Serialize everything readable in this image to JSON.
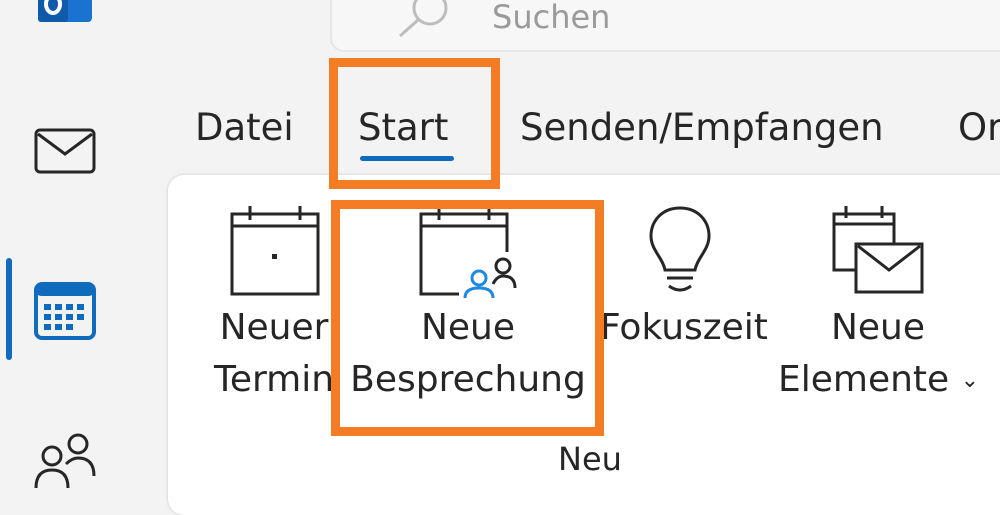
{
  "app": {
    "brand_color": "#0f6cbd",
    "highlight_color": "#f47c25"
  },
  "nav_rail": {
    "items": [
      {
        "icon": "outlook-logo-icon"
      },
      {
        "icon": "mail-icon"
      },
      {
        "icon": "calendar-icon",
        "active": true
      },
      {
        "icon": "people-icon"
      }
    ]
  },
  "search": {
    "placeholder": "Suchen"
  },
  "tabs": [
    {
      "label": "Datei"
    },
    {
      "label": "Start",
      "active": true
    },
    {
      "label": "Senden/Empfangen"
    },
    {
      "label": "Or"
    }
  ],
  "ribbon": {
    "buttons": [
      {
        "label_line1": "Neuer",
        "label_line2": "Termin",
        "icon": "calendar-new-icon"
      },
      {
        "label_line1": "Neue",
        "label_line2": "Besprechung",
        "icon": "calendar-people-icon"
      },
      {
        "label_line1": "Fokuszeit",
        "label_line2": "",
        "icon": "lightbulb-icon"
      },
      {
        "label_line1": "Neue",
        "label_line2": "Elemente",
        "icon": "calendar-mail-icon",
        "dropdown": true
      }
    ],
    "group_label": "Neu"
  }
}
